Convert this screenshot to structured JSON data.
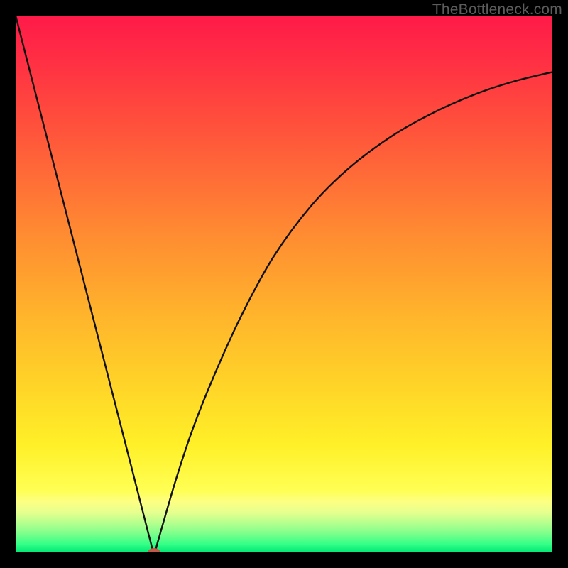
{
  "watermark": "TheBottleneck.com",
  "chart_data": {
    "type": "line",
    "title": "",
    "xlabel": "",
    "ylabel": "",
    "xlim": [
      0,
      100
    ],
    "ylim": [
      0,
      100
    ],
    "grid": false,
    "legend": false,
    "series": [
      {
        "name": "bottleneck-curve",
        "x": [
          0,
          5,
          10,
          14,
          18,
          21.6,
          23,
          24,
          25,
          25.8,
          26.5,
          27.5,
          30,
          33,
          37,
          42,
          48,
          55,
          62,
          70,
          78,
          86,
          93,
          100
        ],
        "y": [
          100,
          80.5,
          61,
          45.4,
          29.8,
          15.8,
          10.3,
          6.4,
          2.5,
          0,
          2,
          5.5,
          14,
          23,
          33,
          44,
          55,
          64.5,
          71.5,
          77.5,
          82,
          85.5,
          87.8,
          89.5
        ]
      }
    ],
    "marker": {
      "name": "optimal-point",
      "x": 25.8,
      "y": 0,
      "color": "#c25a4a",
      "rx": 9,
      "ry": 6
    },
    "gradient_stops": [
      {
        "offset": 0.0,
        "color": "#ff1a49"
      },
      {
        "offset": 0.08,
        "color": "#ff2e44"
      },
      {
        "offset": 0.18,
        "color": "#ff4a3d"
      },
      {
        "offset": 0.3,
        "color": "#ff6c37"
      },
      {
        "offset": 0.42,
        "color": "#ff8f31"
      },
      {
        "offset": 0.55,
        "color": "#ffb22c"
      },
      {
        "offset": 0.68,
        "color": "#ffd228"
      },
      {
        "offset": 0.8,
        "color": "#fff028"
      },
      {
        "offset": 0.885,
        "color": "#ffff54"
      },
      {
        "offset": 0.905,
        "color": "#fdff82"
      },
      {
        "offset": 0.925,
        "color": "#e7ff8e"
      },
      {
        "offset": 0.945,
        "color": "#b6ff8e"
      },
      {
        "offset": 0.965,
        "color": "#7dff8b"
      },
      {
        "offset": 0.985,
        "color": "#33ff86"
      },
      {
        "offset": 1.0,
        "color": "#00e874"
      }
    ]
  }
}
